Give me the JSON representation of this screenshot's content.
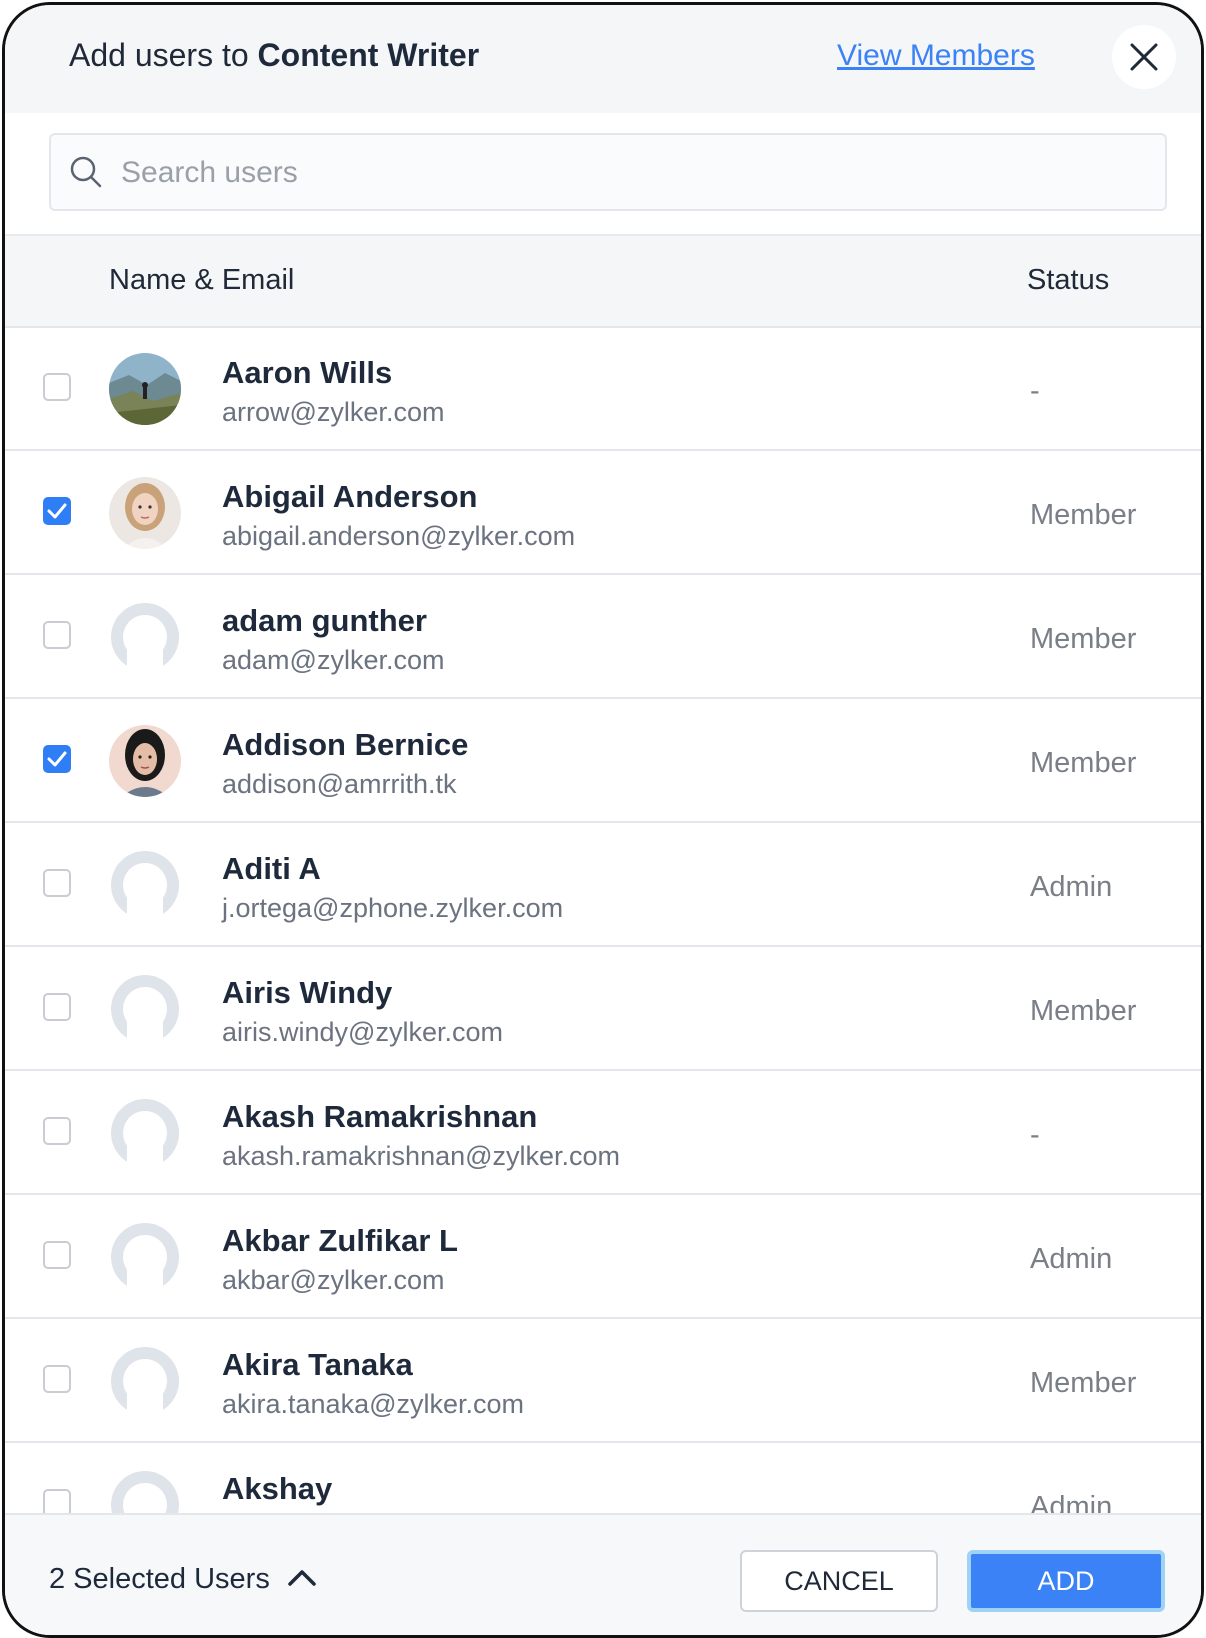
{
  "header": {
    "title_prefix": "Add users to",
    "title_group": "Content Writer",
    "view_members_label": "View Members",
    "close_icon": "close-icon"
  },
  "search": {
    "placeholder": "Search users",
    "value": ""
  },
  "table": {
    "col_name": "Name & Email",
    "col_status": "Status"
  },
  "users": [
    {
      "name": "Aaron Wills",
      "email": "arrow@zylker.com",
      "status": "-",
      "checked": false,
      "avatar": "landscape-photo"
    },
    {
      "name": "Abigail Anderson",
      "email": "abigail.anderson@zylker.com",
      "status": "Member",
      "checked": true,
      "avatar": "woman-photo"
    },
    {
      "name": "adam gunther",
      "email": "adam@zylker.com",
      "status": "Member",
      "checked": false,
      "avatar": "placeholder"
    },
    {
      "name": "Addison Bernice",
      "email": "addison@amrrith.tk",
      "status": "Member",
      "checked": true,
      "avatar": "woman-dark-hair-photo"
    },
    {
      "name": "Aditi A",
      "email": "j.ortega@zphone.zylker.com",
      "status": "Admin",
      "checked": false,
      "avatar": "placeholder"
    },
    {
      "name": "Airis Windy",
      "email": "airis.windy@zylker.com",
      "status": "Member",
      "checked": false,
      "avatar": "placeholder"
    },
    {
      "name": "Akash Ramakrishnan",
      "email": "akash.ramakrishnan@zylker.com",
      "status": "-",
      "checked": false,
      "avatar": "placeholder"
    },
    {
      "name": "Akbar Zulfikar L",
      "email": "akbar@zylker.com",
      "status": "Admin",
      "checked": false,
      "avatar": "placeholder"
    },
    {
      "name": "Akira Tanaka",
      "email": "akira.tanaka@zylker.com",
      "status": "Member",
      "checked": false,
      "avatar": "placeholder"
    },
    {
      "name": "Akshay",
      "email": "",
      "status": "Admin",
      "checked": false,
      "avatar": "placeholder"
    }
  ],
  "footer": {
    "selected_label": "2 Selected Users",
    "chevron_icon": "chevron-up-icon",
    "cancel_label": "CANCEL",
    "add_label": "ADD"
  },
  "colors": {
    "accent": "#3b82f6",
    "checkbox": "#2f7ef5",
    "title": "#1e2a3b"
  }
}
